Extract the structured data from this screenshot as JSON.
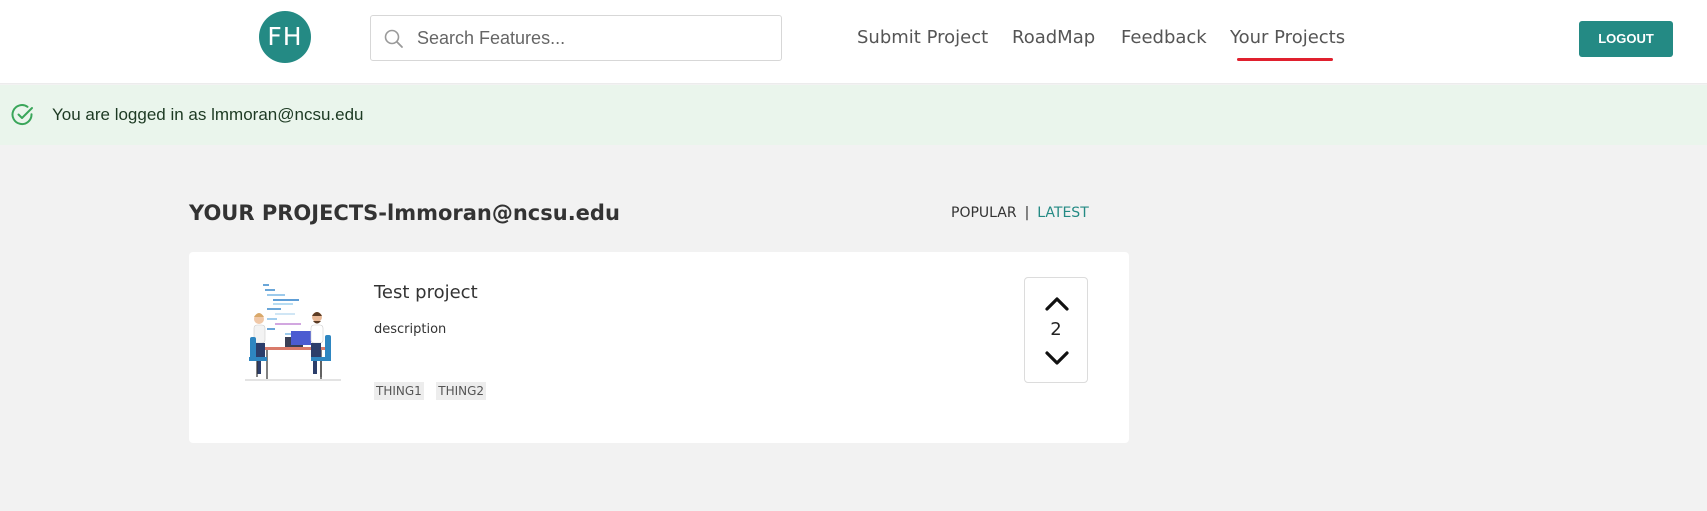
{
  "header": {
    "logo_text": "FH",
    "search_placeholder": "Search Features...",
    "nav": [
      {
        "label": "Submit Project"
      },
      {
        "label": "RoadMap"
      },
      {
        "label": "Feedback"
      },
      {
        "label": "Your Projects",
        "active": true
      }
    ],
    "logout_label": "LOGOUT"
  },
  "alert": {
    "text": "You are logged in as lmmoran@ncsu.edu"
  },
  "main": {
    "title": "YOUR PROJECTS-lmmoran@ncsu.edu",
    "sort": {
      "popular": "POPULAR",
      "separator": "|",
      "latest": "LATEST"
    }
  },
  "projects": [
    {
      "title": "Test project",
      "description": "description",
      "tags": [
        "THING1",
        "THING2"
      ],
      "votes": "2"
    }
  ],
  "colors": {
    "brand": "#248a84",
    "active_underline": "#e0202e",
    "alert_bg": "#eaf5ec",
    "success_icon": "#3aa65a"
  },
  "icons": {
    "search": "search-icon",
    "alert": "check-circle-icon",
    "vote_up": "chevron-up-icon",
    "vote_down": "chevron-down-icon"
  }
}
